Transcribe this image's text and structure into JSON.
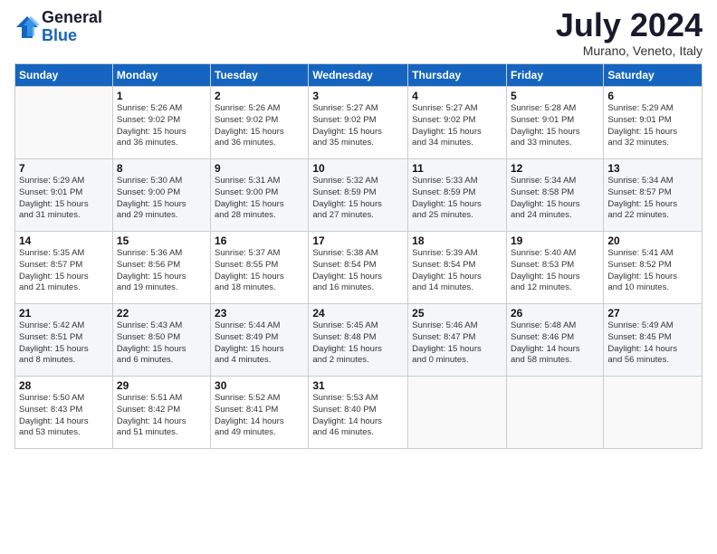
{
  "logo": {
    "general": "General",
    "blue": "Blue"
  },
  "title": {
    "month_year": "July 2024",
    "location": "Murano, Veneto, Italy"
  },
  "days_of_week": [
    "Sunday",
    "Monday",
    "Tuesday",
    "Wednesday",
    "Thursday",
    "Friday",
    "Saturday"
  ],
  "weeks": [
    [
      {
        "day": "",
        "info": ""
      },
      {
        "day": "1",
        "info": "Sunrise: 5:26 AM\nSunset: 9:02 PM\nDaylight: 15 hours\nand 36 minutes."
      },
      {
        "day": "2",
        "info": "Sunrise: 5:26 AM\nSunset: 9:02 PM\nDaylight: 15 hours\nand 36 minutes."
      },
      {
        "day": "3",
        "info": "Sunrise: 5:27 AM\nSunset: 9:02 PM\nDaylight: 15 hours\nand 35 minutes."
      },
      {
        "day": "4",
        "info": "Sunrise: 5:27 AM\nSunset: 9:02 PM\nDaylight: 15 hours\nand 34 minutes."
      },
      {
        "day": "5",
        "info": "Sunrise: 5:28 AM\nSunset: 9:01 PM\nDaylight: 15 hours\nand 33 minutes."
      },
      {
        "day": "6",
        "info": "Sunrise: 5:29 AM\nSunset: 9:01 PM\nDaylight: 15 hours\nand 32 minutes."
      }
    ],
    [
      {
        "day": "7",
        "info": "Sunrise: 5:29 AM\nSunset: 9:01 PM\nDaylight: 15 hours\nand 31 minutes."
      },
      {
        "day": "8",
        "info": "Sunrise: 5:30 AM\nSunset: 9:00 PM\nDaylight: 15 hours\nand 29 minutes."
      },
      {
        "day": "9",
        "info": "Sunrise: 5:31 AM\nSunset: 9:00 PM\nDaylight: 15 hours\nand 28 minutes."
      },
      {
        "day": "10",
        "info": "Sunrise: 5:32 AM\nSunset: 8:59 PM\nDaylight: 15 hours\nand 27 minutes."
      },
      {
        "day": "11",
        "info": "Sunrise: 5:33 AM\nSunset: 8:59 PM\nDaylight: 15 hours\nand 25 minutes."
      },
      {
        "day": "12",
        "info": "Sunrise: 5:34 AM\nSunset: 8:58 PM\nDaylight: 15 hours\nand 24 minutes."
      },
      {
        "day": "13",
        "info": "Sunrise: 5:34 AM\nSunset: 8:57 PM\nDaylight: 15 hours\nand 22 minutes."
      }
    ],
    [
      {
        "day": "14",
        "info": "Sunrise: 5:35 AM\nSunset: 8:57 PM\nDaylight: 15 hours\nand 21 minutes."
      },
      {
        "day": "15",
        "info": "Sunrise: 5:36 AM\nSunset: 8:56 PM\nDaylight: 15 hours\nand 19 minutes."
      },
      {
        "day": "16",
        "info": "Sunrise: 5:37 AM\nSunset: 8:55 PM\nDaylight: 15 hours\nand 18 minutes."
      },
      {
        "day": "17",
        "info": "Sunrise: 5:38 AM\nSunset: 8:54 PM\nDaylight: 15 hours\nand 16 minutes."
      },
      {
        "day": "18",
        "info": "Sunrise: 5:39 AM\nSunset: 8:54 PM\nDaylight: 15 hours\nand 14 minutes."
      },
      {
        "day": "19",
        "info": "Sunrise: 5:40 AM\nSunset: 8:53 PM\nDaylight: 15 hours\nand 12 minutes."
      },
      {
        "day": "20",
        "info": "Sunrise: 5:41 AM\nSunset: 8:52 PM\nDaylight: 15 hours\nand 10 minutes."
      }
    ],
    [
      {
        "day": "21",
        "info": "Sunrise: 5:42 AM\nSunset: 8:51 PM\nDaylight: 15 hours\nand 8 minutes."
      },
      {
        "day": "22",
        "info": "Sunrise: 5:43 AM\nSunset: 8:50 PM\nDaylight: 15 hours\nand 6 minutes."
      },
      {
        "day": "23",
        "info": "Sunrise: 5:44 AM\nSunset: 8:49 PM\nDaylight: 15 hours\nand 4 minutes."
      },
      {
        "day": "24",
        "info": "Sunrise: 5:45 AM\nSunset: 8:48 PM\nDaylight: 15 hours\nand 2 minutes."
      },
      {
        "day": "25",
        "info": "Sunrise: 5:46 AM\nSunset: 8:47 PM\nDaylight: 15 hours\nand 0 minutes."
      },
      {
        "day": "26",
        "info": "Sunrise: 5:48 AM\nSunset: 8:46 PM\nDaylight: 14 hours\nand 58 minutes."
      },
      {
        "day": "27",
        "info": "Sunrise: 5:49 AM\nSunset: 8:45 PM\nDaylight: 14 hours\nand 56 minutes."
      }
    ],
    [
      {
        "day": "28",
        "info": "Sunrise: 5:50 AM\nSunset: 8:43 PM\nDaylight: 14 hours\nand 53 minutes."
      },
      {
        "day": "29",
        "info": "Sunrise: 5:51 AM\nSunset: 8:42 PM\nDaylight: 14 hours\nand 51 minutes."
      },
      {
        "day": "30",
        "info": "Sunrise: 5:52 AM\nSunset: 8:41 PM\nDaylight: 14 hours\nand 49 minutes."
      },
      {
        "day": "31",
        "info": "Sunrise: 5:53 AM\nSunset: 8:40 PM\nDaylight: 14 hours\nand 46 minutes."
      },
      {
        "day": "",
        "info": ""
      },
      {
        "day": "",
        "info": ""
      },
      {
        "day": "",
        "info": ""
      }
    ]
  ]
}
